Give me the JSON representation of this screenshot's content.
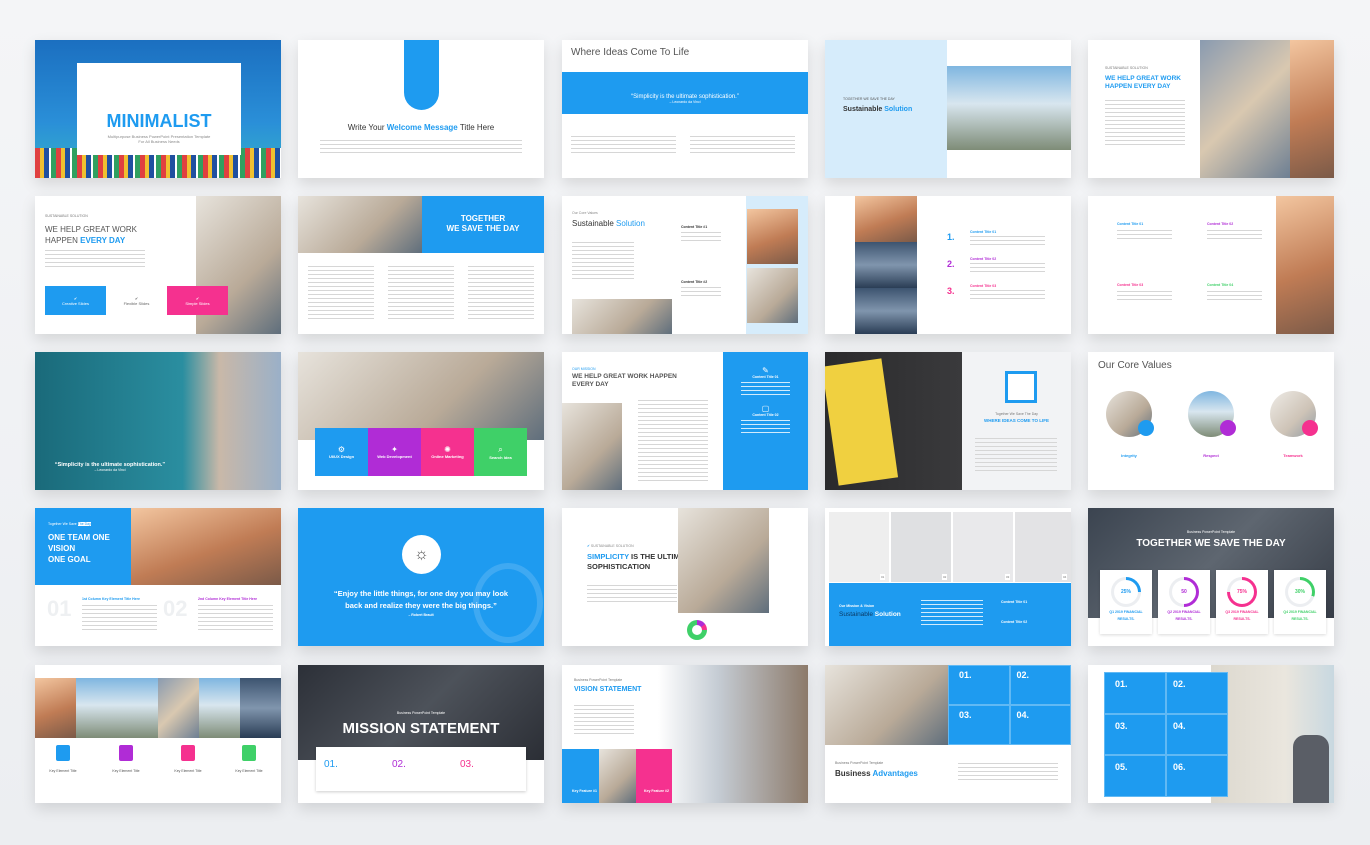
{
  "colors": {
    "accent_blue": "#1e9bf0",
    "accent_pink": "#f5318f",
    "accent_purple": "#b02cd6",
    "accent_green": "#3fd068"
  },
  "slides": [
    {
      "title": "MINIMALIST",
      "subtitle1": "Multipurpose Business PowerPoint Presentation Template",
      "subtitle2": "For All Business Needs"
    },
    {
      "title_pre": "Write Your ",
      "title_accent": "Welcome Message",
      "title_post": " Title Here"
    },
    {
      "title": "Where Ideas Come To Life",
      "quote": "“Simplicity is the ultimate sophistication.”",
      "author": "– Leonardo da Vinci"
    },
    {
      "kicker": "TOGETHER WE SAVE THE DAY",
      "title": "Sustainable ",
      "accent": "Solution"
    },
    {
      "kicker": "SUSTAINABLE SOLUTION",
      "line1": "WE HELP GREAT WORK",
      "line2": "HAPPEN EVERY DAY"
    },
    {
      "kicker": "SUSTAINABLE SOLUTION",
      "line1": "WE HELP GREAT WORK",
      "line2_pre": "HAPPEN ",
      "line2_accent": "EVERY DAY",
      "boxes": [
        "Creative Slides",
        "Flexible Slides",
        "Simple Slides"
      ]
    },
    {
      "title1": "TOGETHER",
      "title2": "WE SAVE THE DAY"
    },
    {
      "kicker": "Our Core Values",
      "title": "Sustainable ",
      "accent": "Solution",
      "c1": "Content Title #1",
      "c2": "Content Title #2"
    },
    {
      "items": [
        {
          "n": "1.",
          "t": "Content Title 01"
        },
        {
          "n": "2.",
          "t": "Content Title 02"
        },
        {
          "n": "3.",
          "t": "Content Title 03"
        }
      ]
    },
    {
      "items": [
        "Content Title 01",
        "Content Title 02",
        "Content Title 03",
        "Content Title 04"
      ]
    },
    {
      "quote": "“Simplicity is the ultimate sophistication.”",
      "author": "– Leonardo da Vinci"
    },
    {
      "boxes": [
        "UI/UX Design",
        "Web Development",
        "Online Marketing",
        "Search Idea"
      ]
    },
    {
      "kicker": "OUR MISSION",
      "line1": "WE HELP GREAT WORK HAPPEN",
      "line2": "EVERY DAY",
      "c1": "Content Title 01",
      "c2": "Content Title 02"
    },
    {
      "kicker": "Together We Save The Day",
      "title": "WHERE IDEAS COME TO LIFE"
    },
    {
      "title": "Our Core Values",
      "items": [
        "Integrity",
        "Respect",
        "Teamwork"
      ]
    },
    {
      "kicker_pre": "Together We Save ",
      "kicker_tag": "The Day",
      "lines": [
        "ONE TEAM ONE",
        "VISION",
        "ONE GOAL"
      ],
      "n1": "01",
      "n2": "02",
      "h1": "1st Column Key Element Title Here",
      "h2": "2nd Column Key Element Title Here"
    },
    {
      "quote1": "“Enjoy the little things, for one day you may look",
      "quote2": "back and realize they were the big things.”",
      "author": "– Robert Brault"
    },
    {
      "kicker": "SUSTAINABLE SOLUTION",
      "accent": "SIMPLICITY",
      "title1": " IS THE ULTIMATE",
      "title2": "SOPHISTICATION"
    },
    {
      "numbers": [
        "01",
        "02",
        "03",
        "04"
      ],
      "kicker": "Our Mission & Vision",
      "title": "Sustainable ",
      "accent": "Solution",
      "c1": "Content Title 01",
      "c2": "Content Title 02"
    },
    {
      "kicker": "Business PowerPoint Template",
      "title": "TOGETHER WE SAVE THE DAY",
      "stats": [
        {
          "value": "25%",
          "fraction": 0.25,
          "label1": "Q1 2019 FINANCIAL",
          "label2": "RESULTS.",
          "color": "#1e9bf0"
        },
        {
          "value": "50",
          "fraction": 0.5,
          "label1": "Q2 2019 FINANCIAL",
          "label2": "RESULTS.",
          "color": "#b02cd6"
        },
        {
          "value": "75%",
          "fraction": 0.75,
          "label1": "Q3 2019 FINANCIAL",
          "label2": "RESULTS.",
          "color": "#f5318f"
        },
        {
          "value": "30%",
          "fraction": 0.3,
          "label1": "Q4 2019 FINANCIAL",
          "label2": "RESULTS.",
          "color": "#3fd068"
        }
      ]
    },
    {
      "items": [
        "Key Element Title",
        "Key Element Title",
        "Key Element Title",
        "Key Element Title"
      ]
    },
    {
      "kicker": "Business PowerPoint Template",
      "title": "MISSION STATEMENT",
      "nums": [
        "01.",
        "02.",
        "03."
      ]
    },
    {
      "kicker": "Business PowerPoint Template",
      "title": "VISION STATEMENT",
      "f1": "Key Feature #1",
      "f2": "Key Feature #2"
    },
    {
      "nums": [
        "01.",
        "02.",
        "03.",
        "04."
      ],
      "kicker": "Business PowerPoint Template",
      "title": "Business ",
      "accent": "Advantages"
    },
    {
      "nums": [
        "01.",
        "02.",
        "03.",
        "04.",
        "05.",
        "06."
      ]
    }
  ]
}
